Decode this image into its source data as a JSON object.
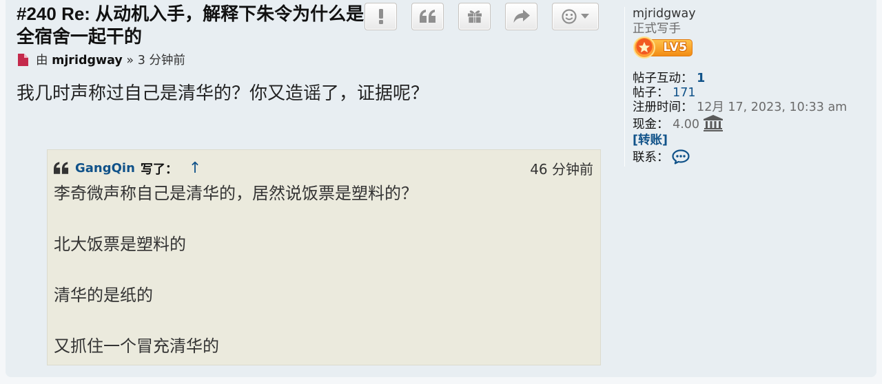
{
  "colors": {
    "page_bg": "#f5f7f9",
    "post_bg": "#e8eef2",
    "link": "#105289",
    "quote_bg": "#ebeadd",
    "quote_border": "#dbdbce",
    "post_icon": "#c42a4c",
    "button_icon": "#8f8f8f"
  },
  "post": {
    "title": "#240 Re: 从动机入手，解释下朱令为什么是全宿舍一起干的",
    "buttons": [
      {
        "icon": "exclamation-icon"
      },
      {
        "icon": "quote-icon"
      },
      {
        "icon": "gift-icon"
      },
      {
        "icon": "share-icon"
      },
      {
        "icon": "smiley-icon",
        "dropdown": true
      }
    ],
    "byline": {
      "icon": "file-icon",
      "prefix": "由",
      "author": "mjridgway",
      "separator": "»",
      "time": "3 分钟前"
    },
    "content": "我几时声称过自己是清华的？你又造谣了，证据呢？",
    "quote": {
      "icon": "quote-icon",
      "author": "GangQin",
      "wrote": "写了：",
      "jump": "↑",
      "time": "46 分钟前",
      "paragraphs": [
        "李奇微声称自己是清华的，居然说饭票是塑料的？",
        "北大饭票是塑料的",
        "清华的是纸的",
        "又抓住一个冒充清华的"
      ]
    }
  },
  "profile": {
    "username": "mjridgway",
    "rank_title": "正式写手",
    "rank_badge": "LV5",
    "stats": [
      {
        "label": "帖子互动：",
        "value": "1"
      },
      {
        "label": "帖子：",
        "value": "171"
      },
      {
        "label": "注册时间：",
        "value": "12月 17, 2023, 10:33 am"
      },
      {
        "label": "现金：",
        "value": "4.00",
        "icon": "bank-icon"
      }
    ],
    "transfer": "[转账]",
    "contact": {
      "label": "联系：",
      "icon": "chat-icon"
    }
  }
}
